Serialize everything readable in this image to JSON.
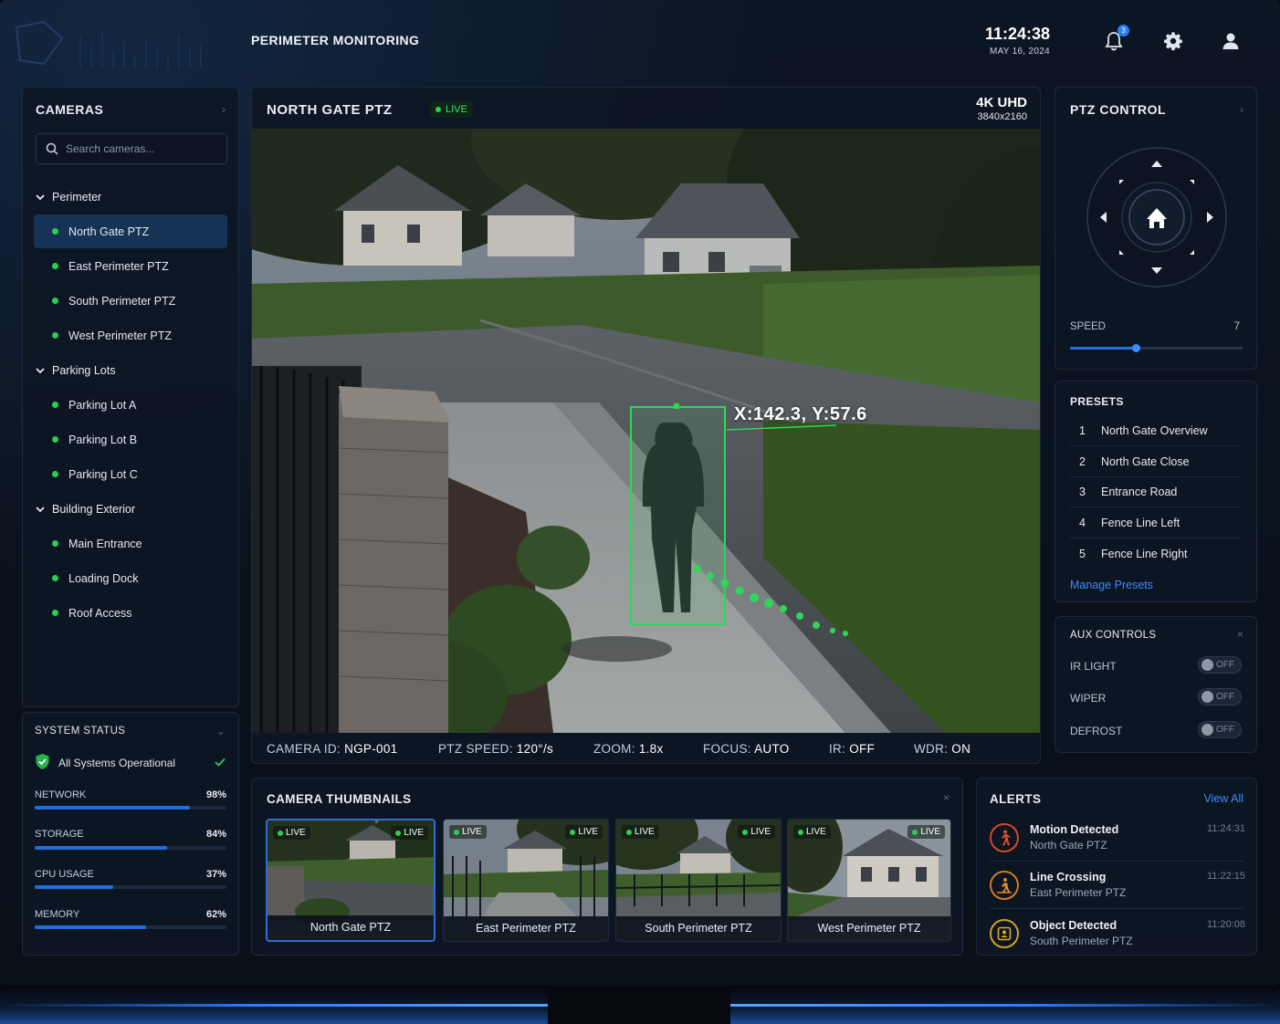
{
  "header": {
    "title": "PERIMETER MONITORING",
    "time": "11:24:38",
    "date": "MAY 16, 2024",
    "notification_count": "3",
    "icons": [
      "bell-icon",
      "gear-icon",
      "user-icon"
    ]
  },
  "cameras": {
    "title": "CAMERAS",
    "search_placeholder": "Search cameras...",
    "groups": [
      {
        "label": "Perimeter",
        "items": [
          "North Gate PTZ",
          "East Perimeter PTZ",
          "South Perimeter PTZ",
          "West Perimeter PTZ"
        ]
      },
      {
        "label": "Parking Lots",
        "items": [
          "Parking Lot A",
          "Parking Lot B",
          "Parking Lot C"
        ]
      },
      {
        "label": "Building Exterior",
        "items": [
          "Main Entrance",
          "Loading Dock",
          "Roof Access"
        ]
      }
    ],
    "selected": "North Gate PTZ",
    "status_color": "#2ecc55"
  },
  "system_status": {
    "title": "SYSTEM STATUS",
    "message": "All Systems Operational",
    "metrics": [
      {
        "label": "NETWORK",
        "value": "98%",
        "fraction": 0.81
      },
      {
        "label": "STORAGE",
        "value": "84%",
        "fraction": 0.69
      },
      {
        "label": "CPU USAGE",
        "value": "37%",
        "fraction": 0.41
      },
      {
        "label": "MEMORY",
        "value": "62%",
        "fraction": 0.58
      }
    ]
  },
  "feed": {
    "title": "NORTH GATE PTZ",
    "live_label": "LIVE",
    "resolution_label": "4K UHD",
    "resolution": "3840x2160",
    "coordinates": "X:142.3, Y:57.6",
    "footer": [
      {
        "label": "CAMERA ID:",
        "value": "NGP-001"
      },
      {
        "label": "PTZ SPEED:",
        "value": "120°/s"
      },
      {
        "label": "ZOOM:",
        "value": "1.8x"
      },
      {
        "label": "FOCUS:",
        "value": "AUTO"
      },
      {
        "label": "IR:",
        "value": "OFF"
      },
      {
        "label": "WDR:",
        "value": "ON"
      }
    ],
    "detection_color": "#2fd65a"
  },
  "ptz": {
    "title": "PTZ CONTROL",
    "speed_label": "SPEED",
    "speed_value": "7",
    "speed_fraction": 0.38
  },
  "presets": {
    "title": "PRESETS",
    "items": [
      {
        "num": "1",
        "label": "North Gate Overview"
      },
      {
        "num": "2",
        "label": "North Gate Close"
      },
      {
        "num": "3",
        "label": "Entrance Road"
      },
      {
        "num": "4",
        "label": "Fence Line Left"
      },
      {
        "num": "5",
        "label": "Fence Line Right"
      }
    ],
    "manage_link": "Manage Presets"
  },
  "aux": {
    "title": "AUX CONTROLS",
    "items": [
      {
        "label": "IR LIGHT",
        "state": "OFF"
      },
      {
        "label": "WIPER",
        "state": "OFF"
      },
      {
        "label": "DEFROST",
        "state": "OFF"
      }
    ]
  },
  "thumbnails": {
    "title": "CAMERA THUMBNAILS",
    "live_label": "LIVE",
    "items": [
      "North Gate PTZ",
      "East Perimeter PTZ",
      "South Perimeter PTZ",
      "West Perimeter PTZ"
    ]
  },
  "alerts": {
    "title": "ALERTS",
    "view_all": "View All",
    "items": [
      {
        "title": "Motion Detected",
        "source": "North Gate PTZ",
        "time": "11:24:31",
        "icon": "walking-person-icon"
      },
      {
        "title": "Line Crossing",
        "source": "East Perimeter PTZ",
        "time": "11:22:15",
        "icon": "line-crossing-icon"
      },
      {
        "title": "Object Detected",
        "source": "South Perimeter PTZ",
        "time": "11:20:08",
        "icon": "object-box-icon"
      }
    ]
  },
  "colors": {
    "accent": "#1f6fe0",
    "link": "#3d8bff",
    "alert": "#d24a2a",
    "live": "#2ecc55"
  }
}
